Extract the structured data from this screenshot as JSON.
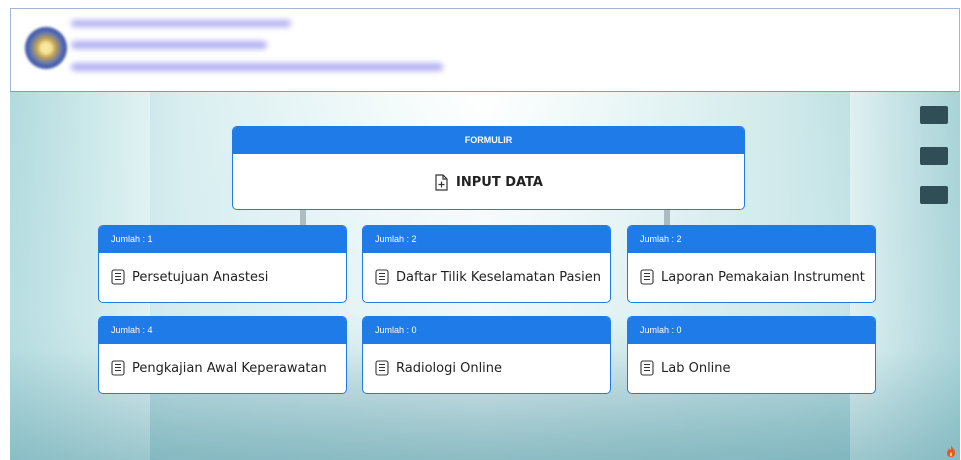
{
  "formulir": {
    "header": "FORMULIR",
    "action_label": "INPUT DATA"
  },
  "cards": [
    {
      "count_label": "Jumlah : 1",
      "title": "Persetujuan Anastesi"
    },
    {
      "count_label": "Jumlah : 2",
      "title": "Daftar Tilik Keselamatan Pasien"
    },
    {
      "count_label": "Jumlah : 2",
      "title": "Laporan Pemakaian Instrument"
    },
    {
      "count_label": "Jumlah : 4",
      "title": "Pengkajian Awal Keperawatan"
    },
    {
      "count_label": "Jumlah : 0",
      "title": "Radiologi Online"
    },
    {
      "count_label": "Jumlah : 0",
      "title": "Lab Online"
    }
  ],
  "icons": {
    "card_icon": "document-list-icon",
    "formulir_icon": "document-plus-icon",
    "corner_icon": "flame-icon"
  },
  "colors": {
    "accent": "#1f7be8"
  }
}
